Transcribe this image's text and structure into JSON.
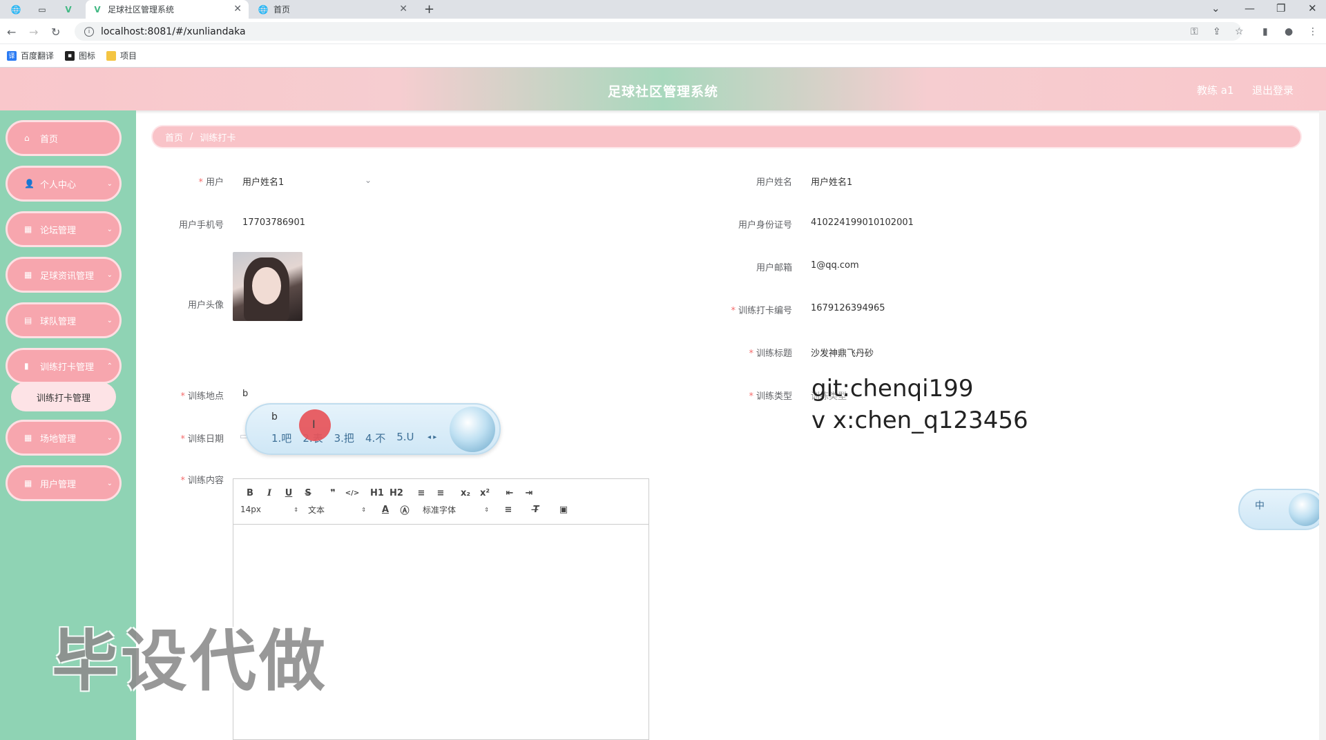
{
  "browser": {
    "tabs": [
      {
        "title": ""
      },
      {
        "title": ""
      },
      {
        "title": ""
      },
      {
        "title": "足球社区管理系统"
      },
      {
        "title": "首页"
      }
    ],
    "new_tab": "+",
    "url": "localhost:8081/#/xunliandaka",
    "bookmarks": [
      "百度翻译",
      "图标",
      "项目"
    ]
  },
  "header": {
    "title": "足球社区管理系统",
    "user": "教练 a1",
    "logout": "退出登录"
  },
  "sidebar": {
    "items": [
      {
        "label": "首页",
        "icon": "home-icon"
      },
      {
        "label": "个人中心",
        "icon": "user-icon"
      },
      {
        "label": "论坛管理",
        "icon": "grid-icon"
      },
      {
        "label": "足球资讯管理",
        "icon": "grid-icon"
      },
      {
        "label": "球队管理",
        "icon": "clipboard-icon"
      },
      {
        "label": "训练打卡管理",
        "icon": "bar-chart-icon"
      },
      {
        "label": "场地管理",
        "icon": "grid-icon"
      },
      {
        "label": "用户管理",
        "icon": "grid-icon"
      }
    ],
    "submenu_active": "训练打卡管理"
  },
  "breadcrumb": {
    "home": "首页",
    "separator": "/",
    "current": "训练打卡"
  },
  "form": {
    "user_label": "用户",
    "user_value": "用户姓名1",
    "user_name_label": "用户姓名",
    "user_name_value": "用户姓名1",
    "phone_label": "用户手机号",
    "phone_value": "17703786901",
    "id_card_label": "用户身份证号",
    "id_card_value": "410224199010102001",
    "email_label": "用户邮箱",
    "email_value": "1@qq.com",
    "avatar_label": "用户头像",
    "checkin_no_label": "训练打卡编号",
    "checkin_no_value": "1679126394965",
    "title_label": "训练标题",
    "title_value": "沙发神鼎飞丹砂",
    "location_label": "训练地点",
    "location_value": "b",
    "type_label": "训练类型",
    "type_placeholder": "训练类型",
    "date_label": "训练日期",
    "content_label": "训练内容"
  },
  "editor": {
    "font_size": "14px",
    "heading": "文本",
    "font_family": "标准字体",
    "buttons": [
      "B",
      "I",
      "U",
      "S",
      "❞",
      "</>",
      "H1",
      "H2",
      "≡",
      "≡",
      "x₂",
      "x²",
      "⇤",
      "⇥"
    ]
  },
  "ime": {
    "composition": "b",
    "candidates": [
      "1.吧",
      "2.表",
      "3.把",
      "4.不",
      "5.U"
    ],
    "mini_label": "中"
  },
  "overlay": {
    "line1": "git:chenqi199",
    "line2": "v x:chen_q123456",
    "watermark": "毕设代做"
  }
}
